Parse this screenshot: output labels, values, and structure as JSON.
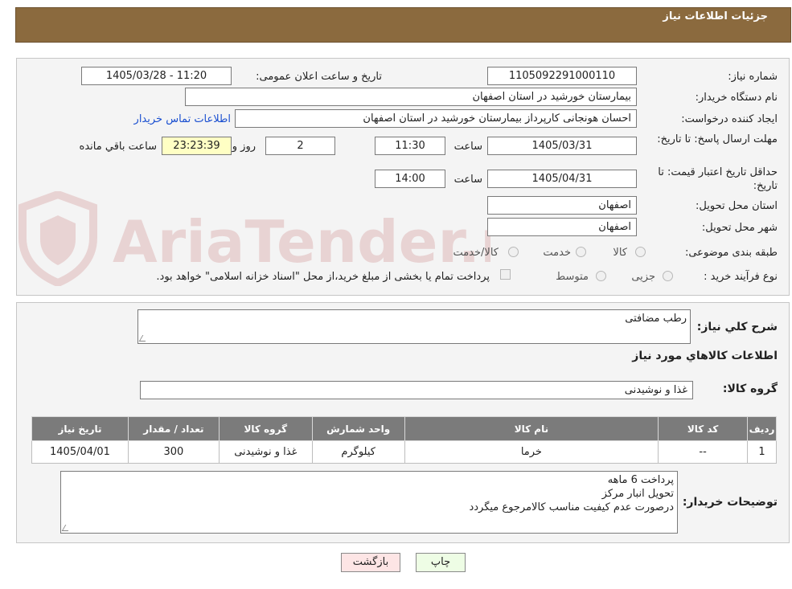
{
  "header": {
    "title": "جزئیات اطلاعات نیاز"
  },
  "form": {
    "need_number": {
      "label": "شماره نیاز:",
      "value": "1105092291000110"
    },
    "announce_datetime": {
      "label": "تاریخ و ساعت اعلان عمومی:",
      "value": "1405/03/28 - 11:20"
    },
    "buyer_org": {
      "label": "نام دستگاه خریدار:",
      "value": "بیمارستان خورشید در استان اصفهان"
    },
    "requester": {
      "label": "ایجاد کننده درخواست:",
      "value": "احسان هونجانی کارپرداز بیمارستان خورشید در استان اصفهان",
      "contact_link": "اطلاعات تماس خریدار"
    },
    "reply_deadline": {
      "label": "مهلت ارسال پاسخ: تا تاریخ:",
      "date": "1405/03/31",
      "time_label": "ساعت",
      "time": "11:30",
      "days": "2",
      "days_label": "روز و",
      "remaining": "23:23:39",
      "remaining_label": "ساعت باقي مانده"
    },
    "price_validity": {
      "label": "حداقل تاریخ اعتبار قیمت: تا تاریخ:",
      "date": "1405/04/31",
      "time_label": "ساعت",
      "time": "14:00"
    },
    "delivery_province": {
      "label": "استان محل تحویل:",
      "value": "اصفهان"
    },
    "delivery_city": {
      "label": "شهر محل تحویل:",
      "value": "اصفهان"
    },
    "category": {
      "label": "طبقه بندی موضوعی:",
      "options": [
        "کالا",
        "خدمت",
        "کالا/خدمت"
      ]
    },
    "process_type": {
      "label": "نوع فرآیند خرید :",
      "options": [
        "جزیی",
        "متوسط"
      ],
      "treasury_note": "پرداخت تمام یا بخشی از مبلغ خرید،از محل \"اسناد خزانه اسلامی\" خواهد بود."
    }
  },
  "details": {
    "general_desc_label": "شرح کلي نياز:",
    "general_desc_value": "رطب مضافتی",
    "items_title": "اطلاعات کالاهاي مورد نياز",
    "goods_group_label": "گروه کالا:",
    "goods_group_value": "غذا و نوشیدنی",
    "table": {
      "headers": [
        "ردیف",
        "کد کالا",
        "نام کالا",
        "واحد شمارش",
        "گروه کالا",
        "تعداد / مقدار",
        "تاریخ نیاز"
      ],
      "rows": [
        [
          "1",
          "--",
          "خرما",
          "کیلوگرم",
          "غذا و نوشیدنی",
          "300",
          "1405/04/01"
        ]
      ]
    },
    "buyer_notes_label": "توضیحات خریدار:",
    "buyer_notes_lines": [
      "پرداخت 6 ماهه",
      "تحویل انبار مرکز",
      "درصورت عدم کیفیت مناسب کالامرجوع میگردد"
    ]
  },
  "buttons": {
    "print": "چاپ",
    "back": "بازگشت"
  },
  "watermark": {
    "text": "AriaTender.neT"
  },
  "colors": {
    "header_bg": "#8b6a3e",
    "table_header_bg": "#7b7b7b",
    "back_button_bg": "#fde5e5",
    "print_button_bg": "#eefde5",
    "remaining_bg": "#ffffc4",
    "link": "#1a4fd0"
  }
}
